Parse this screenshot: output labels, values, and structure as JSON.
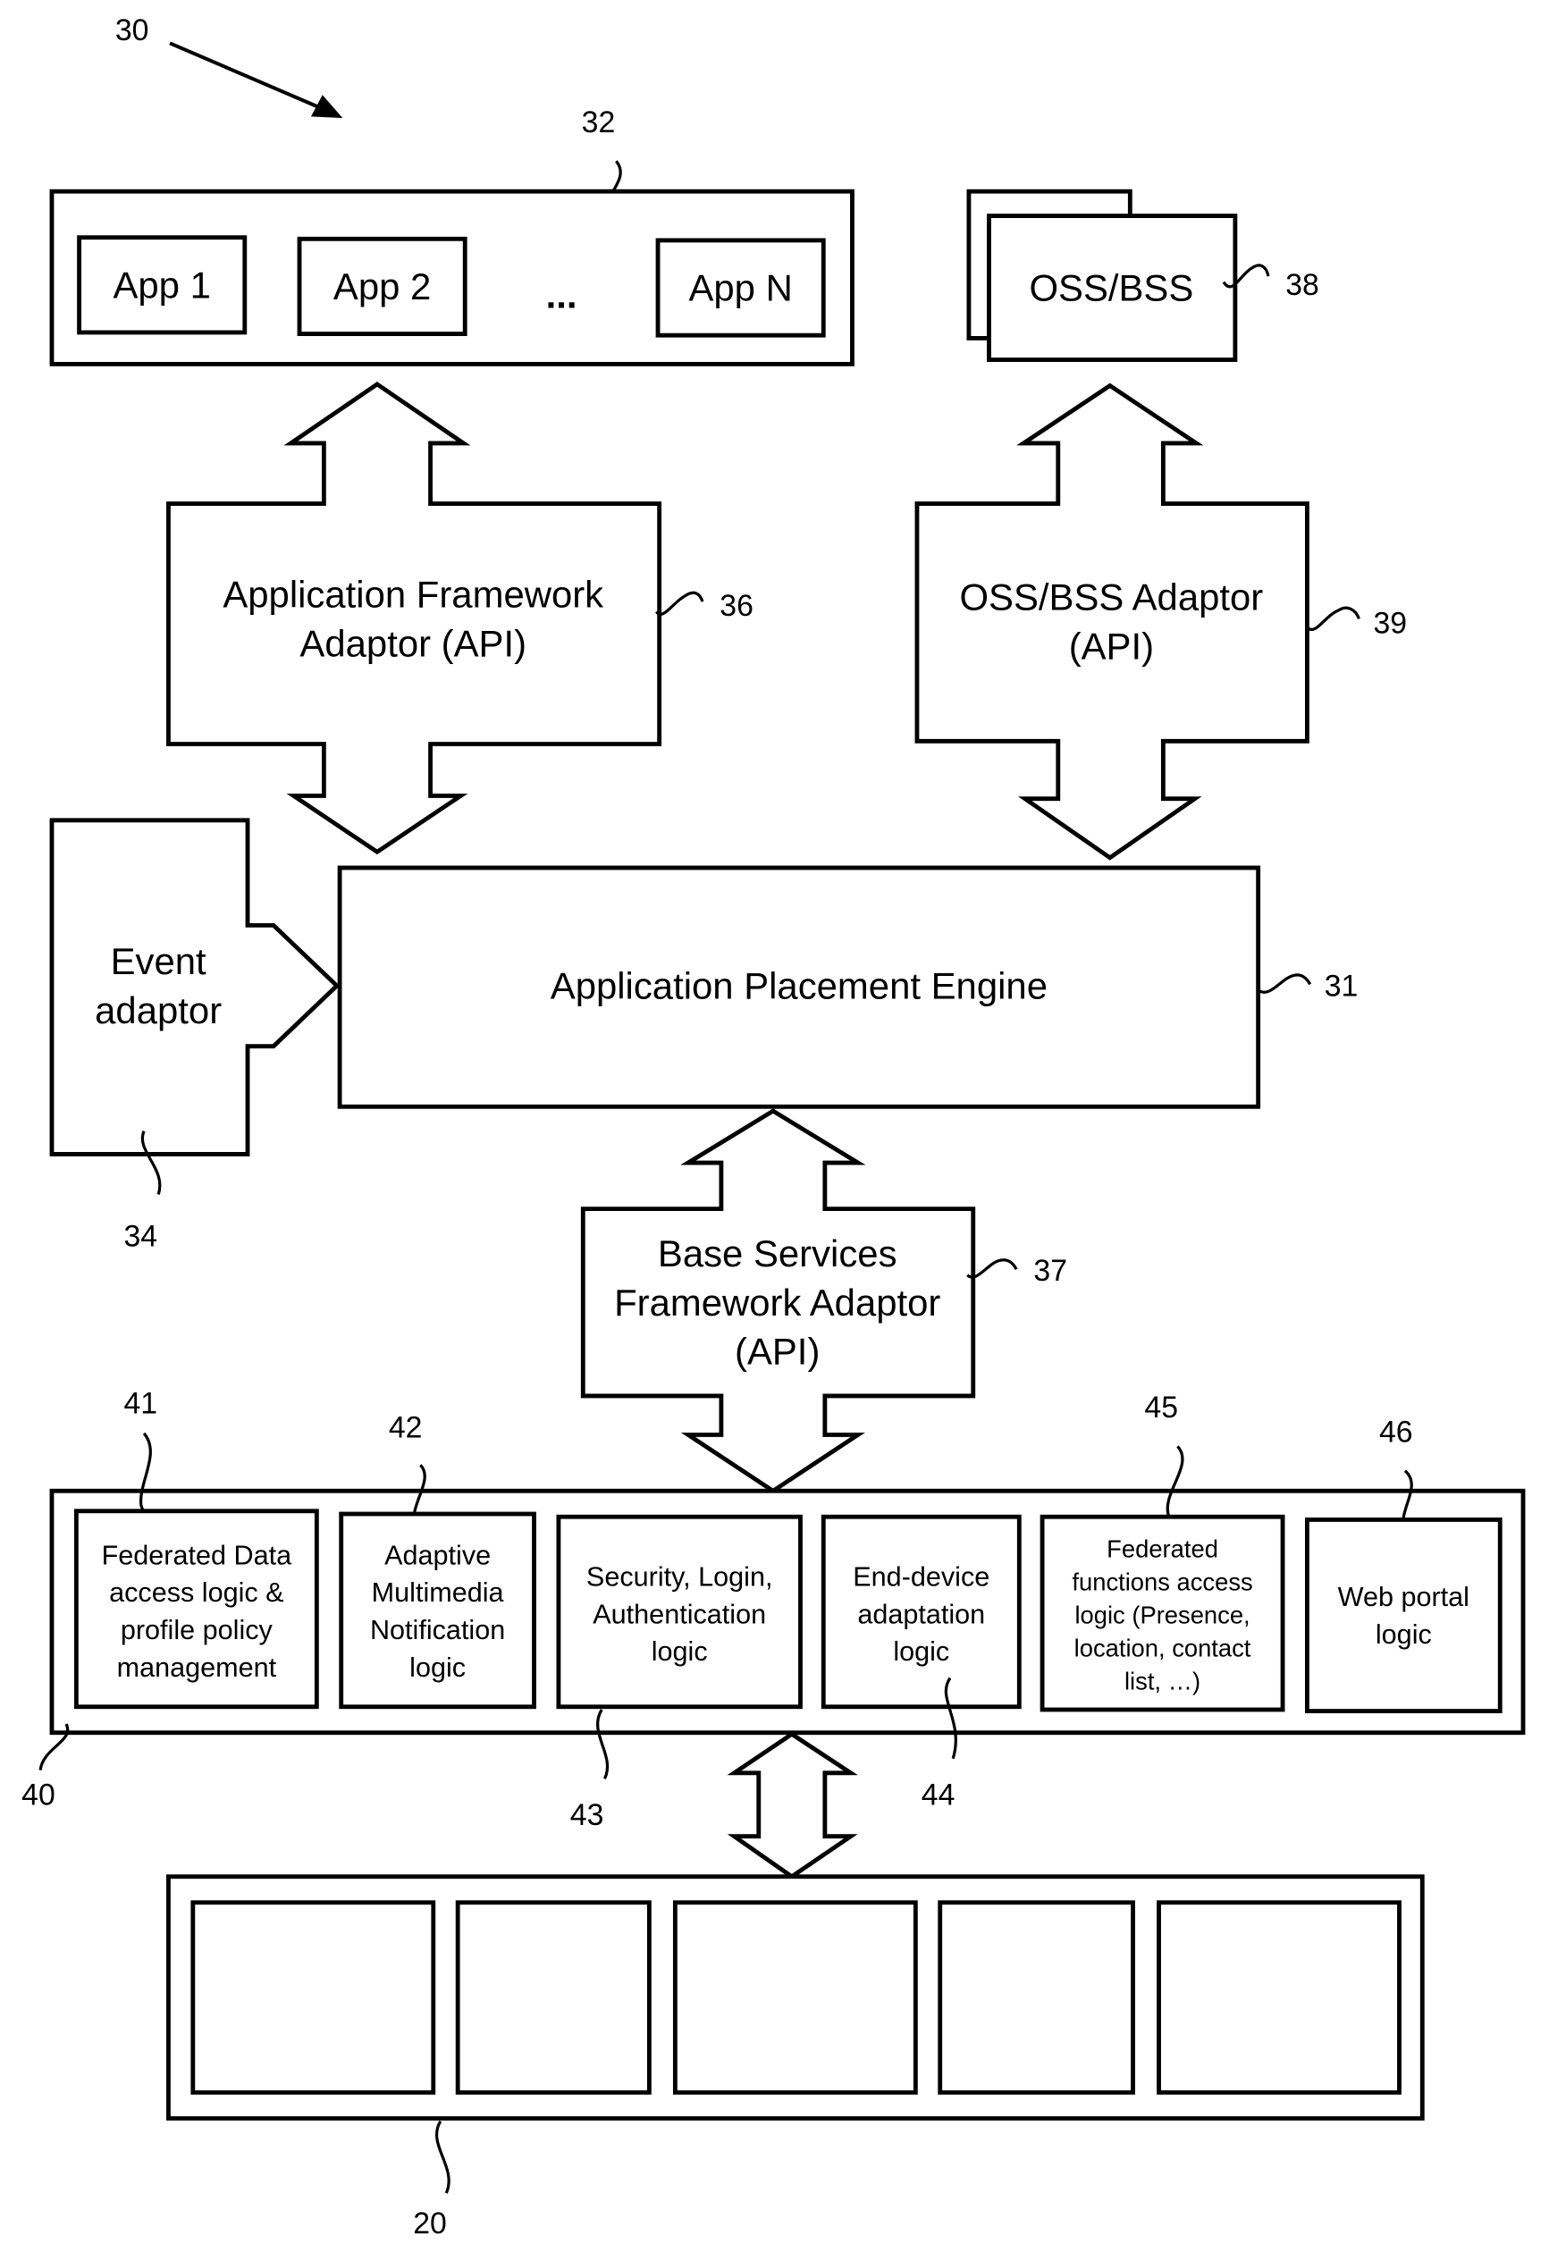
{
  "figure": {
    "ref": "30",
    "apps": {
      "ref": "32",
      "items": [
        "App 1",
        "App 2",
        "App N"
      ],
      "ellipsis": "..."
    },
    "oss_bss": {
      "ref": "38",
      "label": "OSS/BSS"
    },
    "app_framework_adaptor": {
      "ref": "36",
      "lines": [
        "Application Framework",
        "Adaptor (API)"
      ]
    },
    "oss_bss_adaptor": {
      "ref": "39",
      "lines": [
        "OSS/BSS Adaptor",
        "(API)"
      ]
    },
    "event_adaptor": {
      "ref": "34",
      "lines": [
        "Event",
        "adaptor"
      ]
    },
    "placement_engine": {
      "ref": "31",
      "label": "Application Placement Engine"
    },
    "base_services_adaptor": {
      "ref": "37",
      "lines": [
        "Base Services",
        "Framework Adaptor",
        "(API)"
      ]
    },
    "base_services": {
      "ref": "40",
      "modules": [
        {
          "ref": "41",
          "lines": [
            "Federated Data",
            "access logic &",
            "profile policy",
            "management"
          ]
        },
        {
          "ref": "42",
          "lines": [
            "Adaptive",
            "Multimedia",
            "Notification",
            "logic"
          ]
        },
        {
          "ref": "43",
          "lines": [
            "Security, Login,",
            "Authentication",
            "logic"
          ]
        },
        {
          "ref": "44",
          "lines": [
            "End-device",
            "adaptation",
            "logic"
          ]
        },
        {
          "ref": "45",
          "lines": [
            "Federated",
            "functions access",
            "logic (Presence,",
            "location, contact",
            "list, …)"
          ]
        },
        {
          "ref": "46",
          "lines": [
            "Web portal",
            "logic"
          ]
        }
      ]
    },
    "network": {
      "ref": "20",
      "cells": 5
    }
  }
}
